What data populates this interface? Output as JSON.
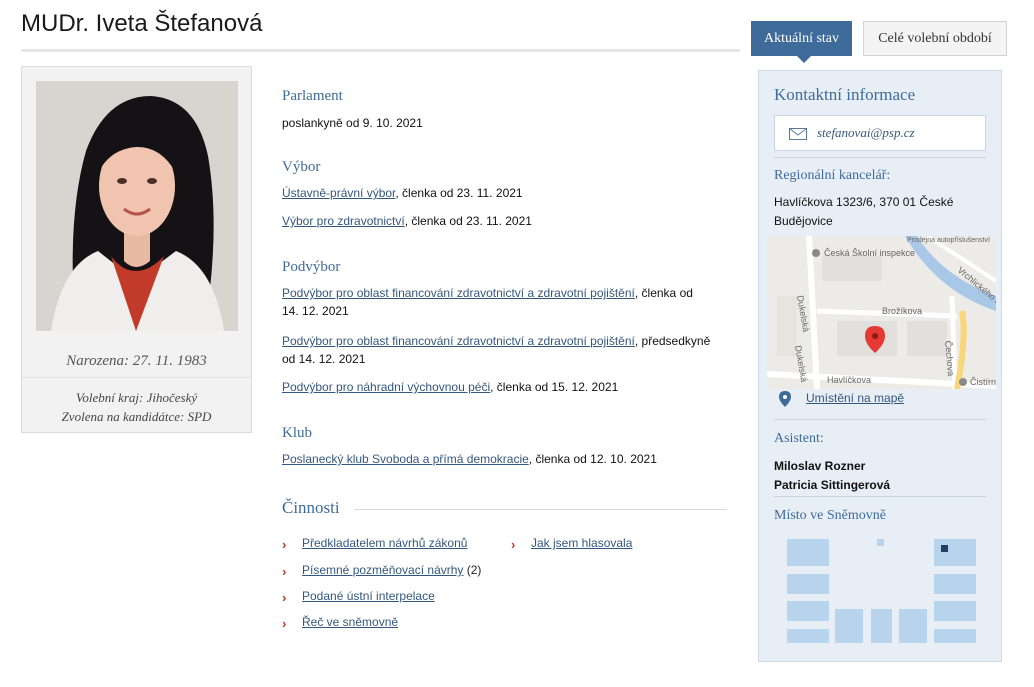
{
  "page": {
    "title": "MUDr. Iveta Štefanová"
  },
  "tabs": {
    "active": "Aktuální stav",
    "inactive": "Celé volební období"
  },
  "profile": {
    "born": "Narozena: 27. 11. 1983",
    "region": "Volební kraj: Jihočeský",
    "candidacy": "Zvolena na kandidátce: SPD"
  },
  "sections": {
    "parlament": {
      "heading": "Parlament",
      "text": "poslankyně od 9. 10. 2021"
    },
    "vybor": {
      "heading": "Výbor",
      "items": [
        {
          "link": "Ústavně-právní výbor",
          "rest": ", členka od 23. 11. 2021"
        },
        {
          "link": "Výbor pro zdravotnictví",
          "rest": ", členka od 23. 11. 2021"
        }
      ]
    },
    "podvybor": {
      "heading": "Podvýbor",
      "items": [
        {
          "link": "Podvýbor pro oblast financování zdravotnictví a zdravotní pojištění",
          "rest": ", členka od",
          "line2": "14. 12. 2021"
        },
        {
          "link": "Podvýbor pro oblast financování zdravotnictví a zdravotní pojištění",
          "rest": ", předsedkyně",
          "line2": "od 14. 12. 2021"
        },
        {
          "link": "Podvýbor pro náhradní výchovnou péči",
          "rest": ", členka od 15. 12. 2021"
        }
      ]
    },
    "klub": {
      "heading": "Klub",
      "link": "Poslanecký klub Svoboda a přímá demokracie",
      "rest": ", členka od 12. 10. 2021"
    }
  },
  "activities": {
    "heading": "Činnosti",
    "items": [
      {
        "label": "Předkladatelem návrhů zákonů",
        "count": ""
      },
      {
        "label": "Jak jsem hlasovala",
        "count": ""
      },
      {
        "label": "Písemné pozměňovací návrhy",
        "count": "(2)"
      },
      {
        "label": "Podané ústní interpelace",
        "count": ""
      },
      {
        "label": "Řeč ve sněmovně",
        "count": ""
      }
    ]
  },
  "sidebar": {
    "title": "Kontaktní informace",
    "email": "stefanovai@psp.cz",
    "office_heading": "Regionální kancelář:",
    "office_address_line1": "Havlíčkova 1323/6, 370 01  České",
    "office_address_line2": "Budějovice",
    "map": {
      "labels": {
        "poi1": "Česká Školní inspekce",
        "poi_top": "Prodejna autopříslušenství",
        "street1": "Dukelská",
        "street2": "Vrchlického n.",
        "street3": "Brožíkova",
        "street4": "Čechova",
        "street5": "Havlíčkova",
        "street6": "Dukelská",
        "poi2": "Čistírn"
      }
    },
    "map_link": "Umístění na mapě",
    "assistant_heading": "Asistent:",
    "assistants": [
      "Miloslav Rozner",
      "Patricia Sittingerová"
    ],
    "seat_heading": "Místo ve Sněmovně"
  },
  "colors": {
    "accent": "#3f6b9a",
    "chevron": "#c0392b",
    "sidebar_bg": "#e7eef5",
    "seat_block": "#b7d4ec",
    "seat_marker": "#1f3f66"
  }
}
